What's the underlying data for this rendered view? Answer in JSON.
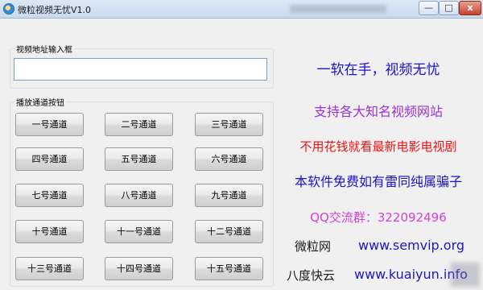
{
  "window": {
    "title": "微粒视频无忧V1.0",
    "min_label": "—",
    "max_label": "□",
    "close_label": "x"
  },
  "url_group": {
    "label": "视频地址输入框",
    "input_value": ""
  },
  "channels_group": {
    "label": "播放通道按钮",
    "buttons": [
      "一号通道",
      "二号通道",
      "三号通道",
      "四号通道",
      "五号通道",
      "六号通道",
      "七号通道",
      "八号通道",
      "九号通道",
      "十号通道",
      "十一号通道",
      "十二号通道",
      "十三号通道",
      "十四号通道",
      "十五号通道"
    ]
  },
  "promo": {
    "line1": "一软在手，视频无忧",
    "line2": "支持各大知名视频网站",
    "line3": "不用花钱就看最新电影电视剧",
    "line4": "本软件免费如有雷同纯属骗子",
    "line5": "QQ交流群：322092496",
    "colors": {
      "line1": "#1a14c9",
      "line2": "#9b33d6",
      "line3": "#ee1313",
      "line4": "#1a14c9",
      "line5": "#d43fd6"
    }
  },
  "sites": [
    {
      "name": "微粒网",
      "url": "www.semvip.org"
    },
    {
      "name": "八度快云",
      "url": "www.kuaiyun.info"
    }
  ]
}
